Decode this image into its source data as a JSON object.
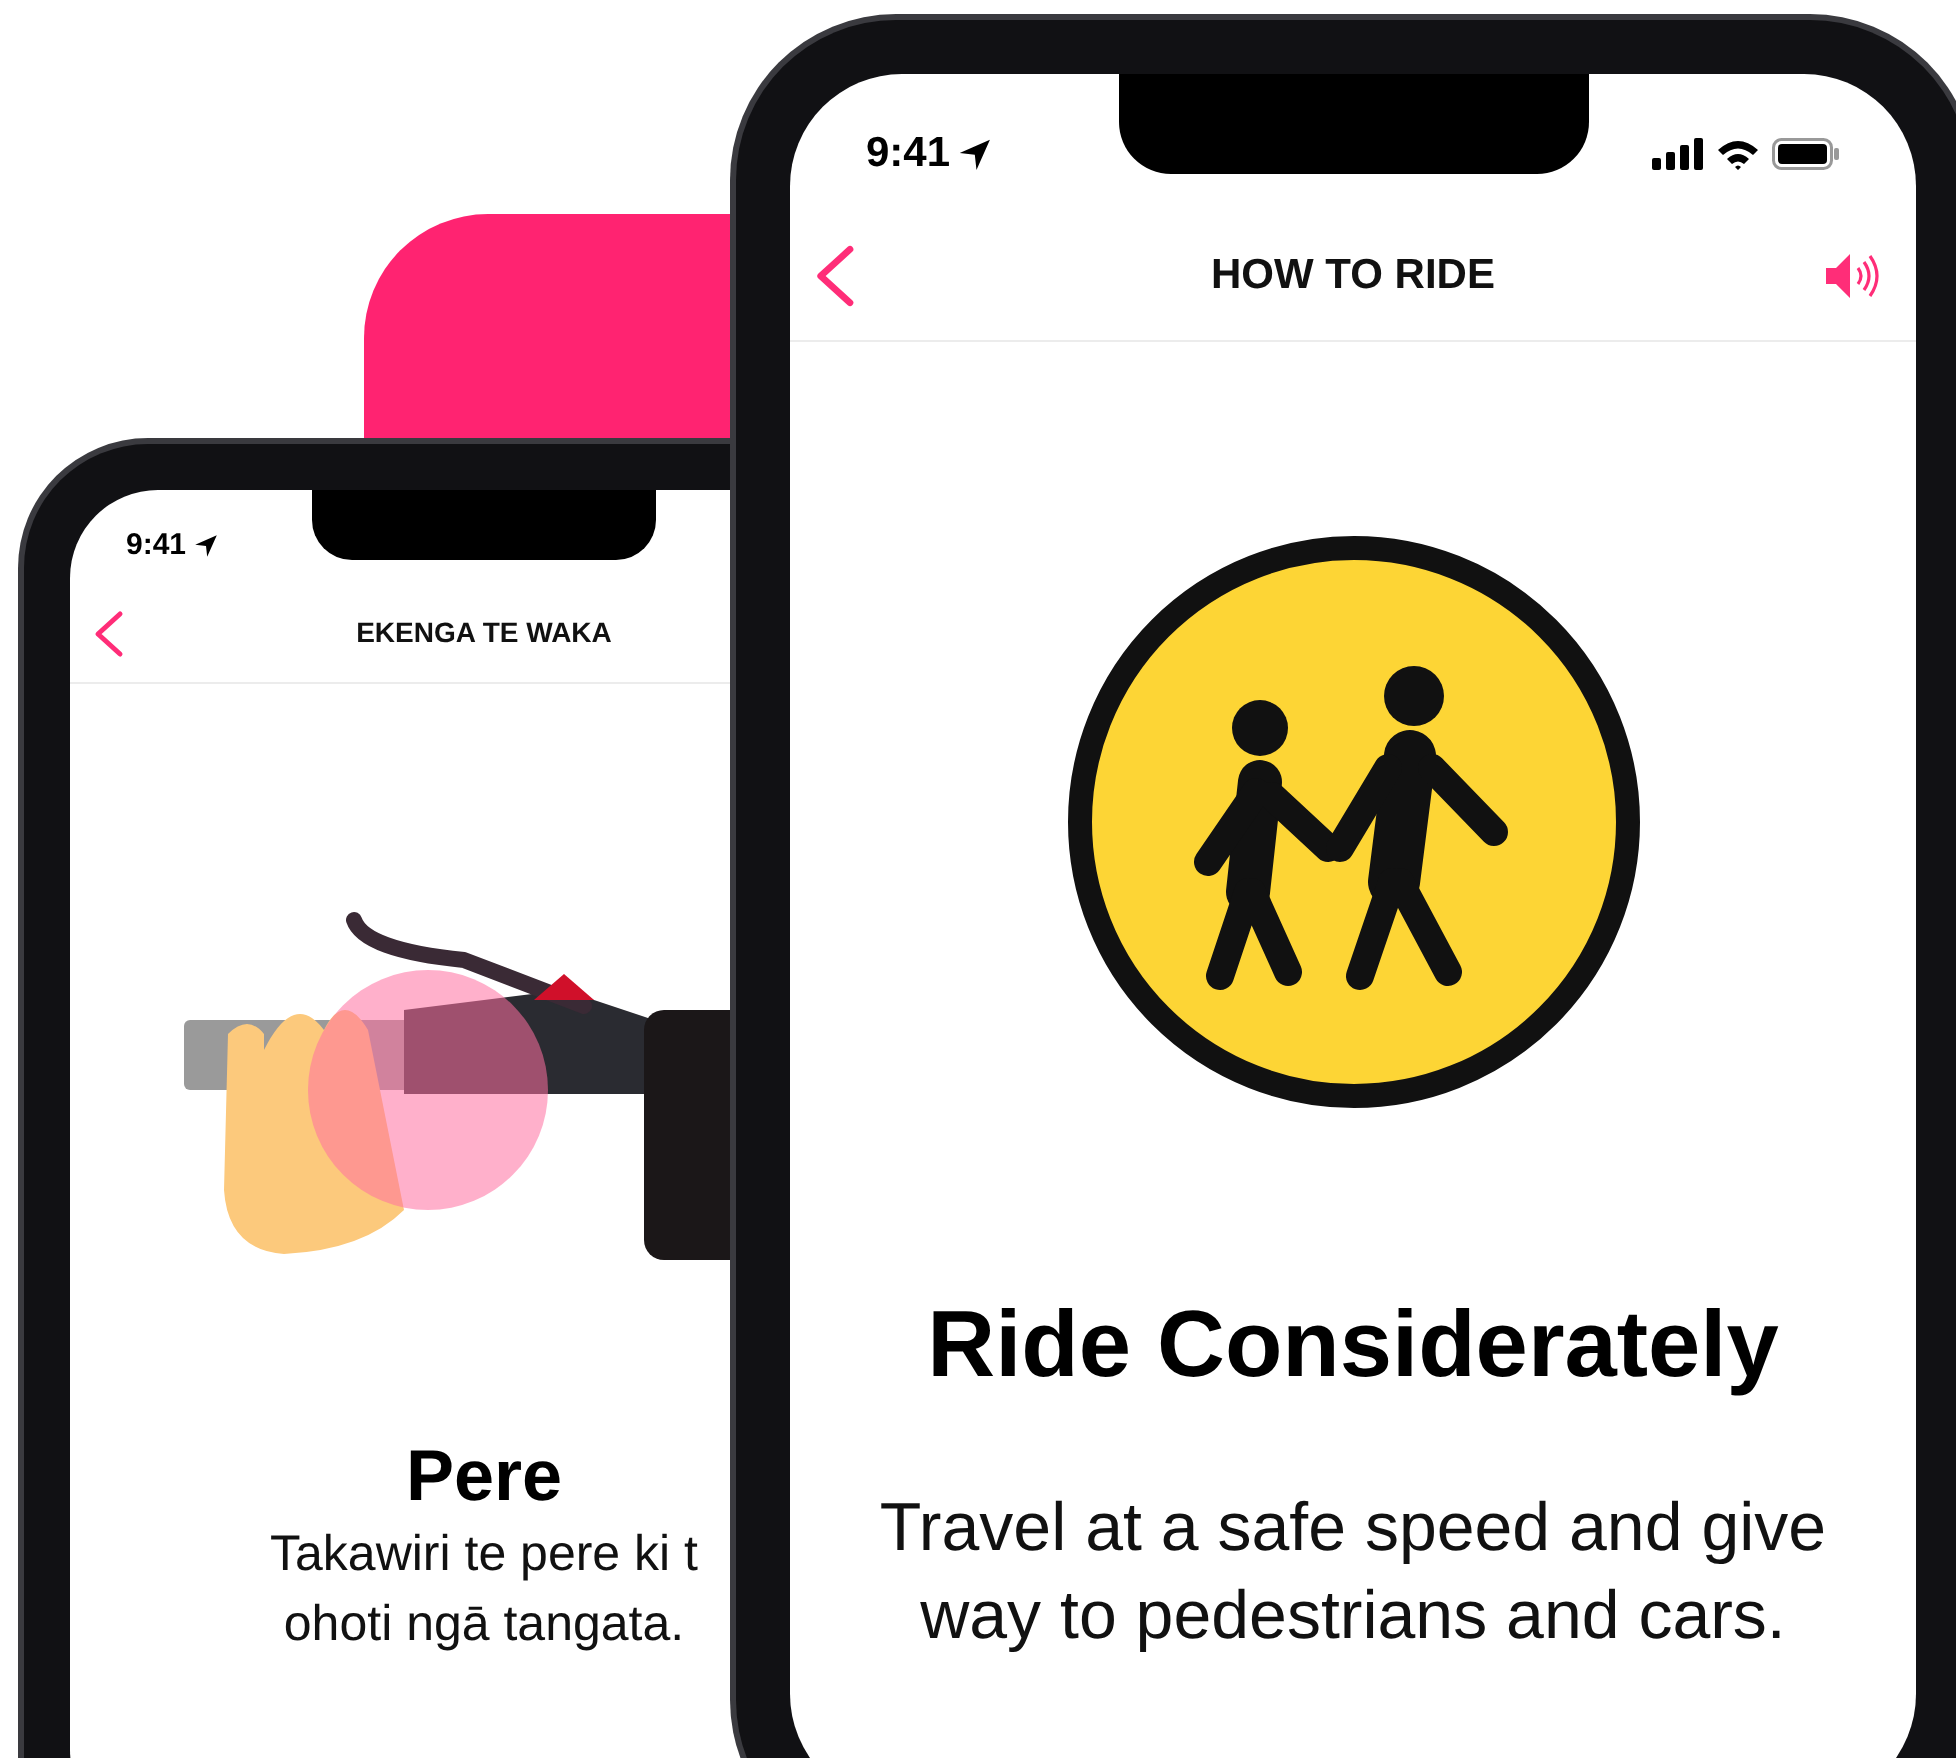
{
  "phones": [
    {
      "kind": "back",
      "status_bar": {
        "time": "9:41"
      },
      "nav": {
        "title": "EKENGA TE WAKA"
      },
      "illustration": {
        "kind": "bell-grip"
      },
      "heading": "Pere",
      "body_lines": [
        "Takawiri te pere ki t",
        "ohoti ngā tangata."
      ]
    },
    {
      "kind": "front",
      "status_bar": {
        "time": "9:41",
        "icons": true
      },
      "nav": {
        "title": "HOW TO RIDE",
        "sound_button": true
      },
      "illustration": {
        "kind": "pedestrians"
      },
      "heading": "Ride Considerately",
      "body_lines": [
        "Travel at a safe speed and give",
        "way to pedestrians and cars."
      ]
    }
  ]
}
